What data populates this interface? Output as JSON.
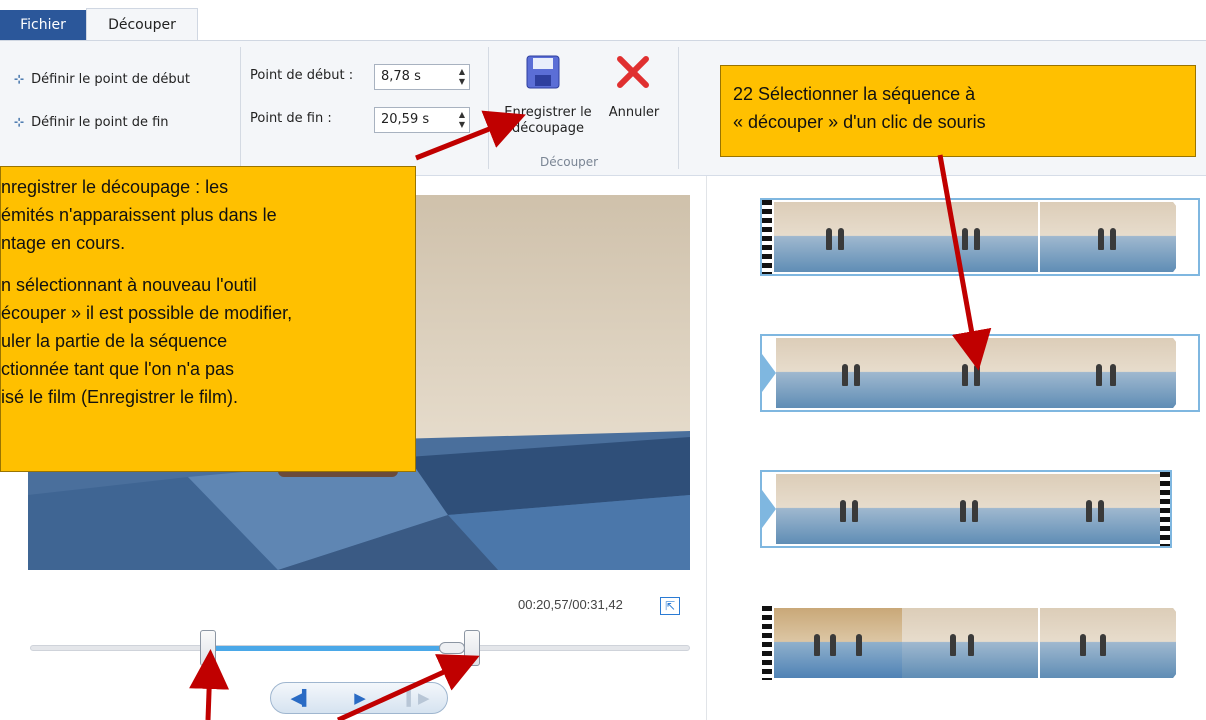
{
  "tabs": {
    "file": "Fichier",
    "trim": "Découper"
  },
  "ribbon": {
    "set_start": "Définir le point de début",
    "set_end": "Définir le point de fin",
    "start_label": "Point de début :",
    "start_value": "8,78 s",
    "end_label": "Point de fin :",
    "end_value": "20,59 s",
    "save_line1": "Enregistrer le",
    "save_line2": "découpage",
    "cancel": "Annuler",
    "group_label": "Découper"
  },
  "annotations": {
    "left": [
      "nregistrer le découpage : les",
      "émités n'apparaissent plus dans le",
      "ntage en cours.",
      "",
      "n sélectionnant à nouveau l'outil",
      "écouper » il est possible de modifier,",
      "uler la partie de la séquence",
      "ctionnée tant que l'on n'a pas",
      "isé le film (Enregistrer le film)."
    ],
    "right_line1": "22 Sélectionner la séquence à",
    "right_line2": "« découper » d'un clic de souris"
  },
  "player": {
    "timecode": "00:20,57/00:31,42",
    "trim_start_fraction": 0.27,
    "trim_end_fraction": 0.67,
    "playhead_fraction": 0.64
  },
  "colors": {
    "accent": "#2b579a",
    "callout": "#ffc000",
    "arrow": "#c00000",
    "selection": "#4aa8e8"
  },
  "icons": {
    "save": "floppy-disk-icon",
    "cancel": "red-x-icon",
    "expand": "expand-arrow-icon"
  }
}
